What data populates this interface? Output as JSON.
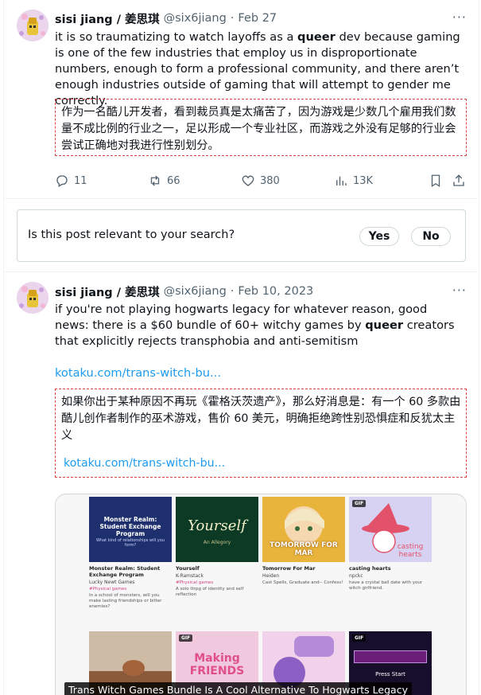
{
  "tweet1": {
    "display_name": "sisi jiang / 姜思琪",
    "handle": "@six6jiang",
    "separator": "·",
    "date": "Feb 27",
    "more": "···",
    "text_pre": "it is so traumatizing to watch layoffs as a ",
    "text_bold": "queer",
    "text_post": " dev because gaming is one of the few industries that employ us in disproportionate numbers, enough to form a professional community, and there aren’t enough industries outside of gaming that will attempt to gender me correctly.",
    "translation": "作为一名酷儿开发者，看到裁员真是太痛苦了，因为游戏是少数几个雇用我们数量不成比例的行业之一，足以形成一个专业社区，而游戏之外没有足够的行业会尝试正确地对我进行性别划分。",
    "replies": "11",
    "reposts": "66",
    "likes": "380",
    "views": "13K"
  },
  "relevance": {
    "question": "Is this post relevant to your search?",
    "yes_label": "Yes",
    "no_label": "No"
  },
  "tweet2": {
    "display_name": "sisi jiang / 姜思琪",
    "handle": "@six6jiang",
    "separator": "·",
    "date": "Feb 10, 2023",
    "more": "···",
    "text_pre": "if you're not playing hogwarts legacy for whatever reason, good news: there is a $60 bundle of 60+ witchy games by ",
    "text_bold": "queer",
    "text_post": " creators that explicitly rejects transphobia and anti-semitism",
    "link": "kotaku.com/trans-witch-bu...",
    "translation": "如果你出于某种原因不再玩《霍格沃茨遗产》，那么好消息是：有一个 60 多款由酷儿创作者制作的巫术游戏，售价 60 美元，明确拒绝跨性别恐惧症和反犹太主义",
    "translation_link": "kotaku.com/trans-witch-bu...",
    "card_caption": "Trans Witch Games Bundle Is A Cool Alternative To Hogwarts Legacy",
    "games": [
      {
        "title": "Monster Realm: Student Exchange Program",
        "studio": "Lucky Newt Games",
        "tag": "#Physical games",
        "desc": "In a school of monsters, will you make lasting friendships or bitter enemies?",
        "thumb_text": "Monster Realm: Student Exchange Program",
        "thumb_sub": "What kind of relationships will you form?"
      },
      {
        "title": "Yourself",
        "studio": "K-Ramstack",
        "tag": "#Physical games",
        "desc": "A solo ttrpg of identity and self reflection",
        "thumb_text": "Yourself",
        "thumb_sub": "An Allegory"
      },
      {
        "title": "Tomorrow For Mar",
        "studio": "Heiden",
        "tag": "",
        "desc": "Cast Spells, Graduate and-- Confess!",
        "thumb_text": "TOMORROW FOR MAR",
        "thumb_sub": ""
      },
      {
        "title": "casting hearts",
        "studio": "npckc",
        "tag": "",
        "desc": "have a crystal ball date with your witch girlfriend.",
        "thumb_text": "casting hearts",
        "thumb_sub": "",
        "gif": "GIF"
      },
      {
        "title": "",
        "studio": "",
        "tag": "",
        "desc": "",
        "thumb_text": "",
        "thumb_sub": ""
      },
      {
        "title": "",
        "studio": "",
        "tag": "",
        "desc": "",
        "thumb_text": "Making FRIENDS",
        "thumb_sub": "",
        "gif": "GIF"
      },
      {
        "title": "",
        "studio": "",
        "tag": "",
        "desc": "",
        "thumb_text": "",
        "thumb_sub": ""
      },
      {
        "title": "",
        "studio": "",
        "tag": "",
        "desc": "",
        "thumb_text": "Press Start",
        "thumb_sub": "",
        "gif": "GIF"
      }
    ]
  }
}
